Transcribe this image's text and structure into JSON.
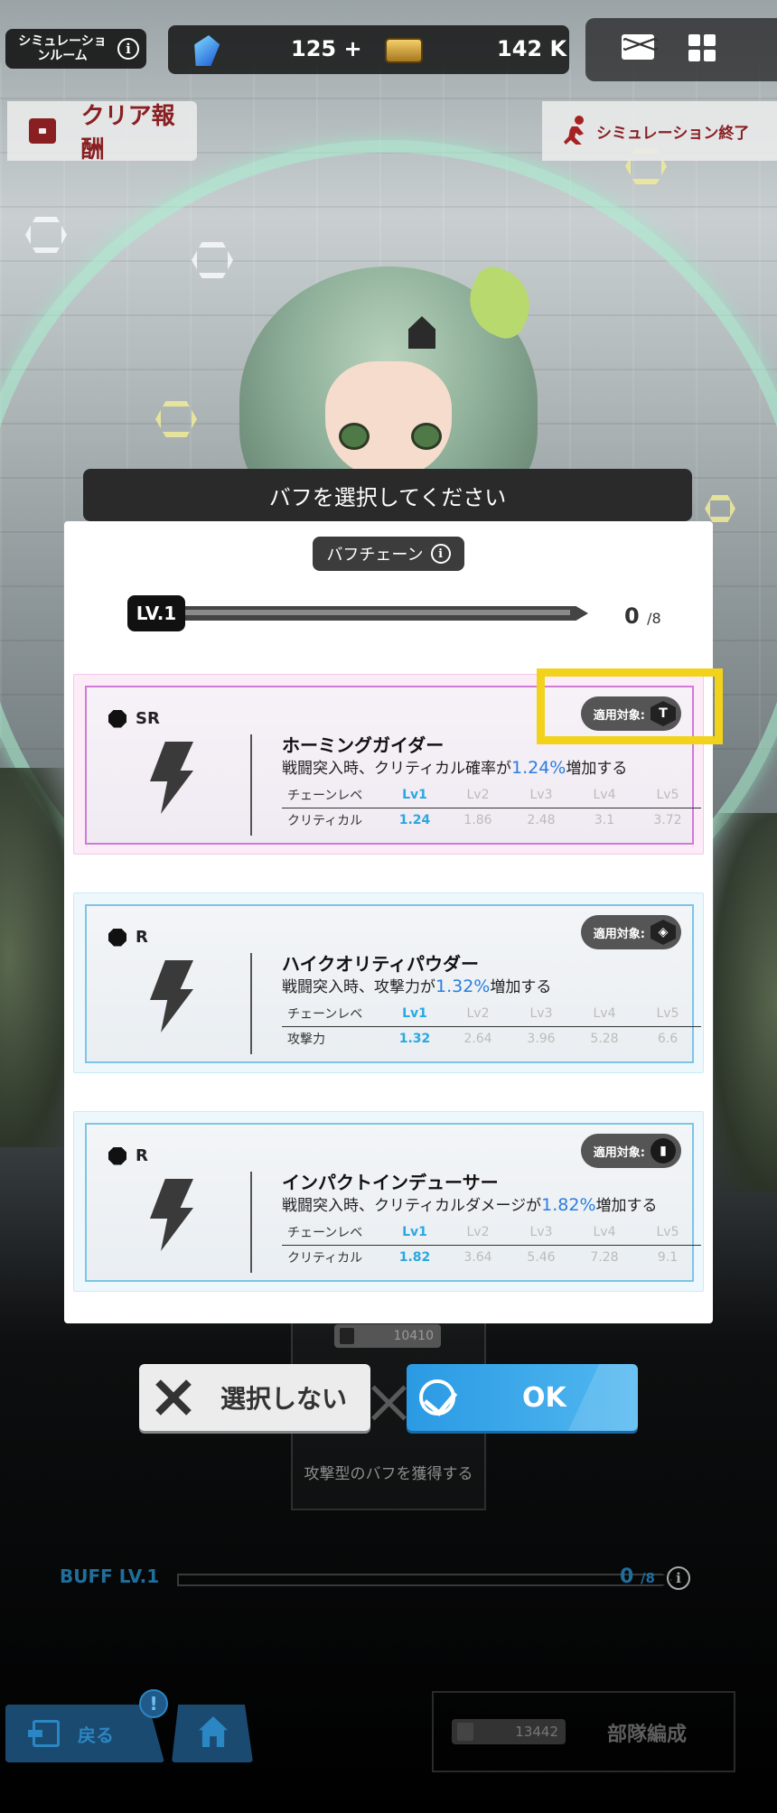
{
  "topbar": {
    "room_label": "シミュレーションルーム",
    "gem_count": "125 +",
    "gold_count": "142 K"
  },
  "actions": {
    "clear_reward": "クリア報酬",
    "end_simulation": "シミュレーション終了"
  },
  "modal": {
    "prompt": "バフを選択してください",
    "chain_title": "バフチェーン",
    "level_label": "LV.1",
    "level_count": "0",
    "level_max": "/8",
    "table_header": [
      "チェーンレベ",
      "Lv1",
      "Lv2",
      "Lv3",
      "Lv4",
      "Lv5"
    ],
    "target_label": "適用対象:",
    "cards": [
      {
        "rarity": "SR",
        "name": "ホーミングガイダー",
        "desc_pre": "戦闘突入時、クリティカル確率が",
        "desc_value": "1.24%",
        "desc_post": "増加する",
        "stat_label": "クリティカル",
        "values": [
          "1.24",
          "1.86",
          "2.48",
          "3.1",
          "3.72"
        ],
        "target_icon": "tower-class-icon"
      },
      {
        "rarity": "R",
        "name": "ハイクオリティパウダー",
        "desc_pre": "戦闘突入時、攻撃力が",
        "desc_value": "1.32%",
        "desc_post": "増加する",
        "stat_label": "攻撃力",
        "values": [
          "1.32",
          "2.64",
          "3.96",
          "5.28",
          "6.6"
        ],
        "target_icon": "diamond-class-icon"
      },
      {
        "rarity": "R",
        "name": "インパクトインデューサー",
        "desc_pre": "戦闘突入時、クリティカルダメージが",
        "desc_value": "1.82%",
        "desc_post": "増加する",
        "stat_label": "クリティカル",
        "values": [
          "1.82",
          "3.64",
          "5.46",
          "7.28",
          "9.1"
        ],
        "target_icon": "weapon-class-icon"
      }
    ]
  },
  "buttons": {
    "skip": "選択しない",
    "ok": "OK"
  },
  "background": {
    "ghost_power": "10410",
    "ghost_text": "攻撃型のバフを獲得する",
    "buff_label": "BUFF LV.1",
    "buff_count": "0",
    "buff_max": "/8"
  },
  "footer": {
    "back": "戻る",
    "alert": "!",
    "formation_power": "13442",
    "formation": "部隊編成"
  },
  "colors": {
    "accent_blue": "#2a9ae4",
    "highlight_yellow": "#f2d21a",
    "sr_border": "#cf7bd7",
    "r_border": "#7ec4e6",
    "reward_red": "#8a1f22"
  }
}
